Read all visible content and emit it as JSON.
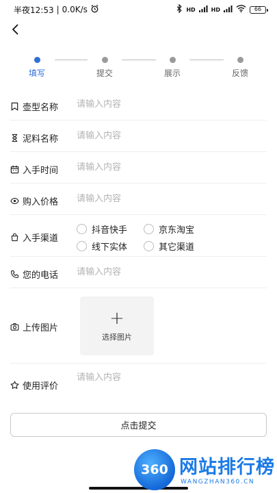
{
  "status_bar": {
    "time": "半夜12:53",
    "separator": "|",
    "net_speed": "0.0K/s",
    "sig1": "HD",
    "sig2": "HD",
    "battery": "66"
  },
  "stepper": {
    "steps": [
      {
        "label": "填写",
        "active": true
      },
      {
        "label": "提交",
        "active": false
      },
      {
        "label": "展示",
        "active": false
      },
      {
        "label": "反馈",
        "active": false
      }
    ]
  },
  "form": {
    "pot_name": {
      "label": "壶型名称",
      "placeholder": "请输入内容"
    },
    "clay_name": {
      "label": "泥料名称",
      "placeholder": "请输入内容"
    },
    "purchase_time": {
      "label": "入手时间",
      "placeholder": "请输入内容"
    },
    "purchase_price": {
      "label": "购入价格",
      "placeholder": "请输入内容"
    },
    "channel": {
      "label": "入手渠道",
      "options": [
        "抖音快手",
        "京东淘宝",
        "线下实体",
        "其它渠道"
      ]
    },
    "phone": {
      "label": "您的电话",
      "placeholder": "请输入内容"
    },
    "upload": {
      "label": "上传图片",
      "button_icon": "+",
      "button_label": "选择图片"
    },
    "review": {
      "label": "使用评价",
      "placeholder": "请输入内容"
    }
  },
  "submit_label": "点击提交",
  "watermark": {
    "logo_text": "360",
    "title": "网站排行榜",
    "subtitle": "WANGZHAN360.CN"
  },
  "colors": {
    "accent": "#2f6fd8",
    "watermark": "#1a7ae6"
  }
}
